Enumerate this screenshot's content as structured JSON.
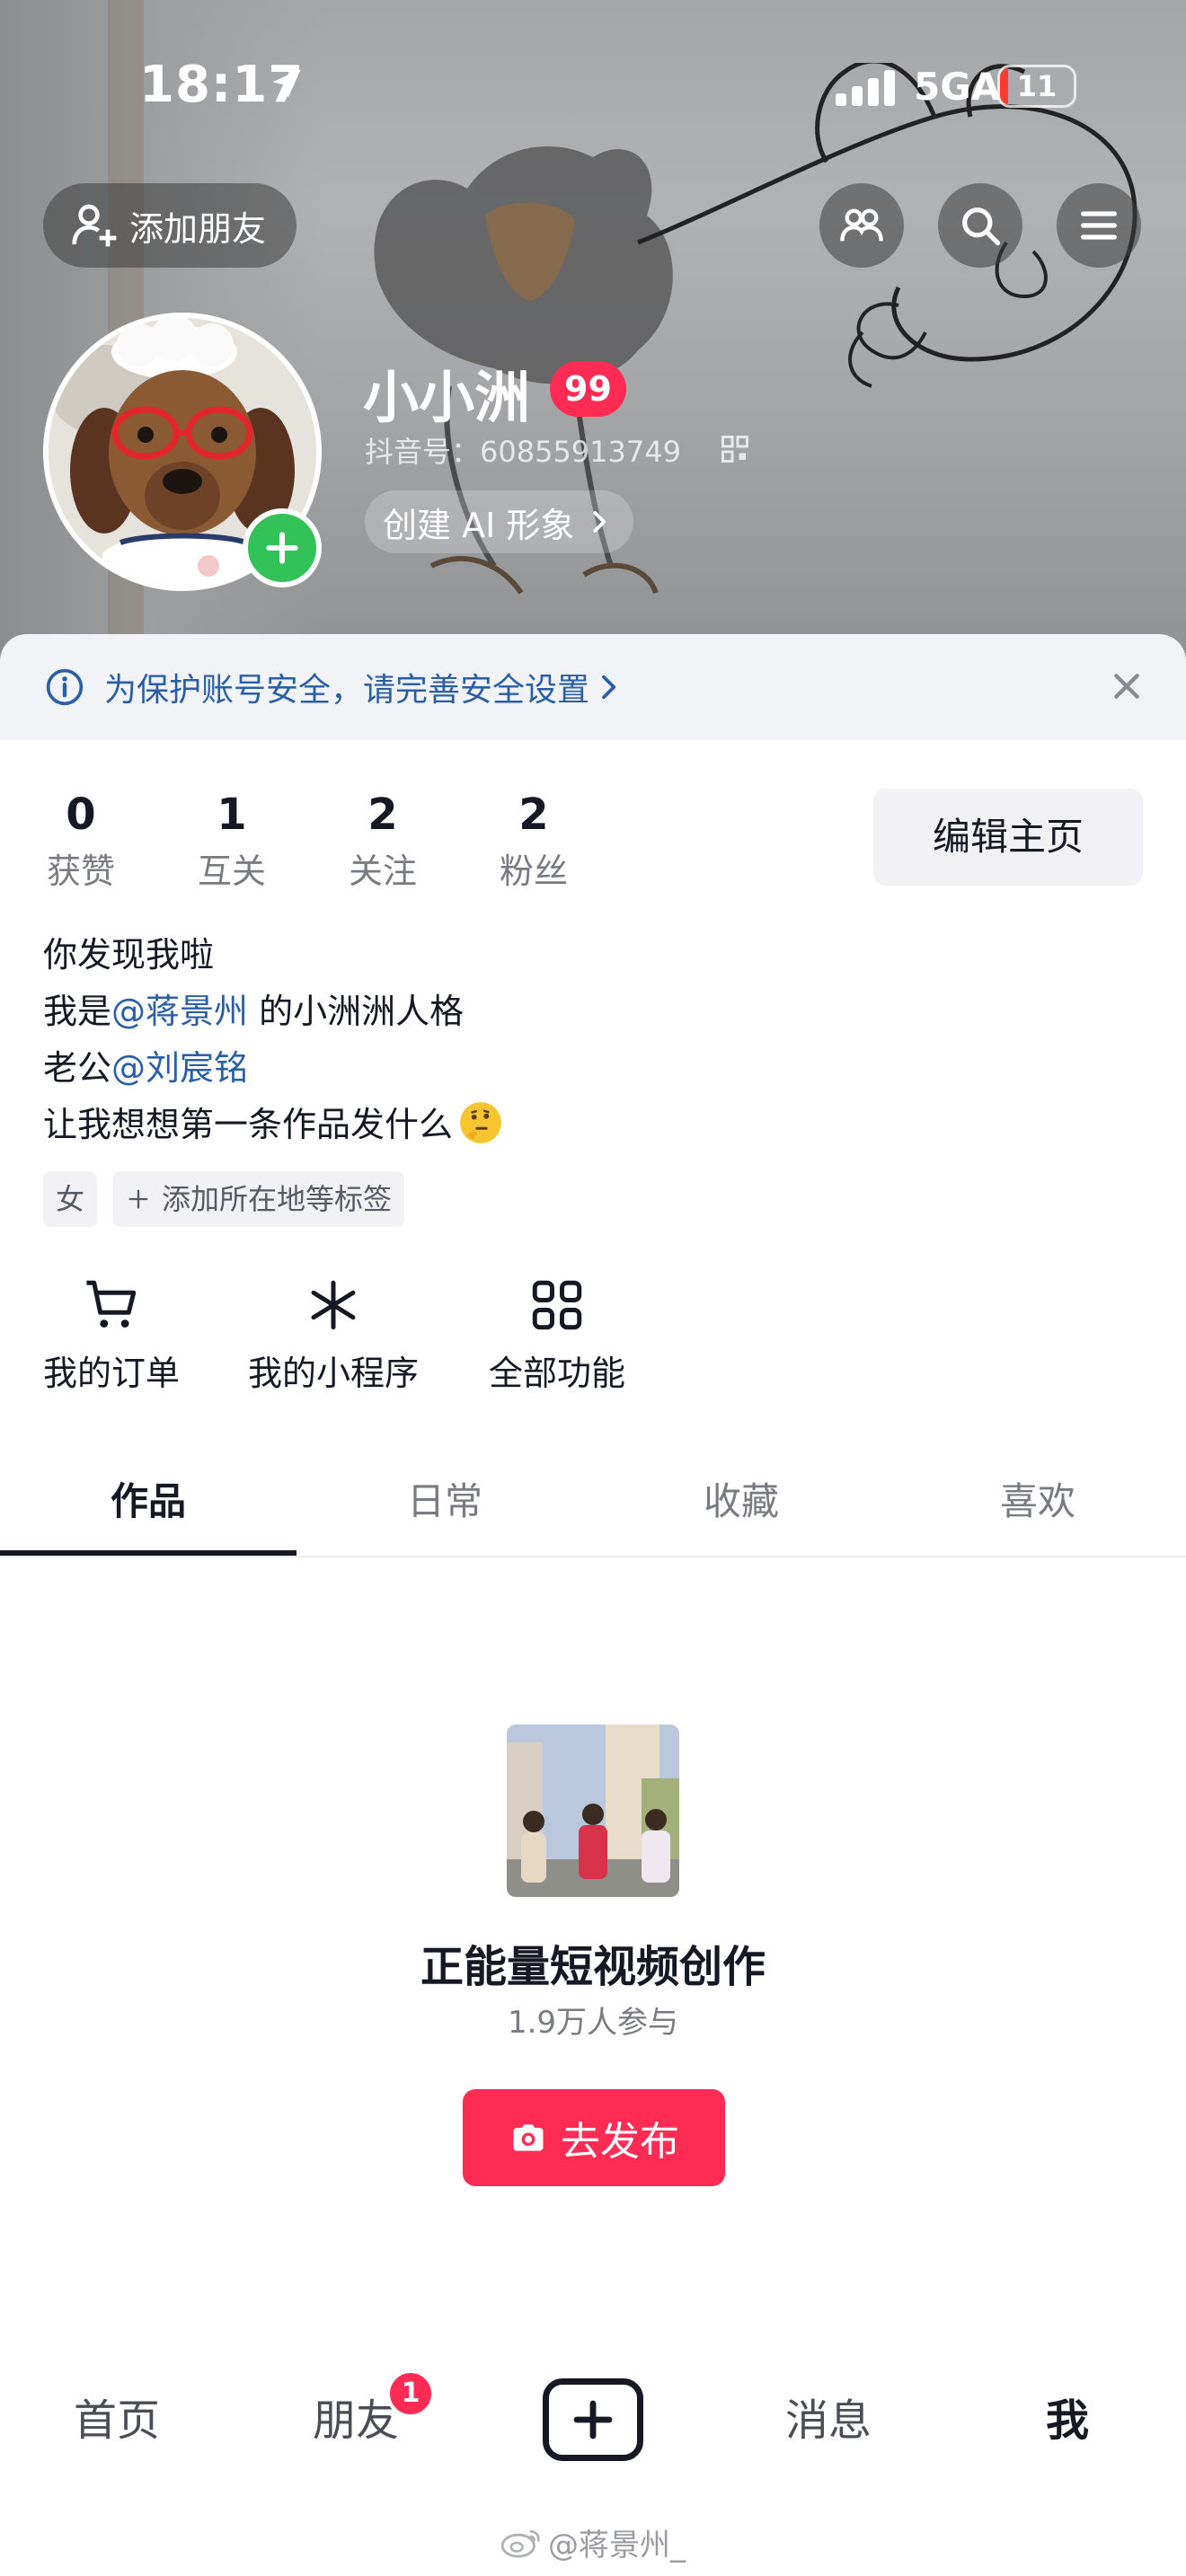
{
  "status_bar": {
    "time": "18:17",
    "network": "5GA",
    "battery": "11",
    "battery_level": 0.11
  },
  "header": {
    "add_friend_label": "添加朋友",
    "nickname": "小小洲",
    "level_badge": "99",
    "douyin_id": "抖音号：60855913749",
    "ai_button_label": "创建 AI 形象",
    "icons": [
      "friends-icon",
      "search-icon",
      "menu-icon"
    ]
  },
  "security_banner": {
    "text": "为保护账号安全，请完善安全设置"
  },
  "stats": [
    {
      "value": "0",
      "label": "获赞"
    },
    {
      "value": "1",
      "label": "互关"
    },
    {
      "value": "2",
      "label": "关注"
    },
    {
      "value": "2",
      "label": "粉丝"
    }
  ],
  "edit_button_label": "编辑主页",
  "bio": {
    "line1": "你发现我啦",
    "line2_prefix": "我是",
    "line2_mention": "@蒋景州",
    "line2_suffix": " 的小洲洲人格",
    "line3_prefix": "老公",
    "line3_mention": "@刘宸铭",
    "line4": "让我想想第一条作品发什么"
  },
  "tags": {
    "gender": "女",
    "add_label": "添加所在地等标签"
  },
  "tools": [
    {
      "label": "我的订单",
      "icon": "cart-icon"
    },
    {
      "label": "我的小程序",
      "icon": "mini-program-icon"
    },
    {
      "label": "全部功能",
      "icon": "grid-icon"
    }
  ],
  "tabs": [
    {
      "label": "作品",
      "active": true
    },
    {
      "label": "日常",
      "active": false
    },
    {
      "label": "收藏",
      "active": false
    },
    {
      "label": "喜欢",
      "active": false
    }
  ],
  "promo": {
    "title": "正能量短视频创作",
    "participants": "1.9万人参与",
    "button_label": "去发布"
  },
  "bottom_nav": {
    "home": "首页",
    "friends": "朋友",
    "friends_badge": "1",
    "messages": "消息",
    "me": "我"
  },
  "watermark": "@蒋景州_",
  "colors": {
    "accent": "#fe2c55",
    "link": "#2a5fa8",
    "online_green": "#33c257"
  }
}
